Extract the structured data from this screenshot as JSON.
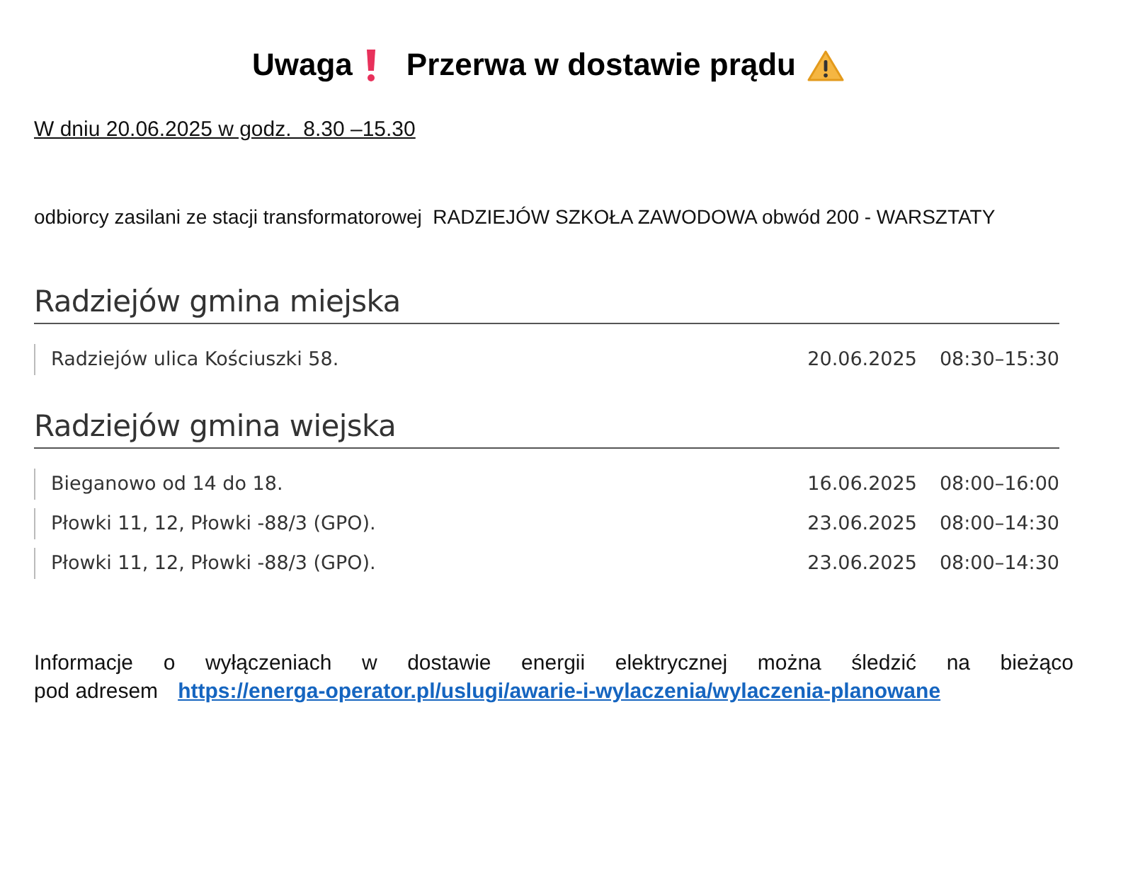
{
  "title": {
    "lead": "Uwaga",
    "text": "Przerwa w dostawie prądu"
  },
  "date_line": "W dniu 20.06.2025 w godz.  8.30 –15.30",
  "recipients": "odbiorcy zasilani ze stacji transformatorowej  RADZIEJÓW SZKOŁA ZAWODOWA obwód 200 - WARSZTATY",
  "sections": [
    {
      "heading": "Radziejów gmina miejska",
      "rows": [
        {
          "place": "Radziejów ulica Kościuszki 58.",
          "date": "20.06.2025",
          "hours": "08:30–15:30"
        }
      ]
    },
    {
      "heading": "Radziejów gmina wiejska",
      "rows": [
        {
          "place": "Bieganowo od 14 do 18.",
          "date": "16.06.2025",
          "hours": "08:00–16:00"
        },
        {
          "place": "Płowki 11, 12, Płowki -88/3 (GPO).",
          "date": "23.06.2025",
          "hours": "08:00–14:30"
        },
        {
          "place": "Płowki 11, 12, Płowki -88/3 (GPO).",
          "date": "23.06.2025",
          "hours": "08:00–14:30"
        }
      ]
    }
  ],
  "info": {
    "line_1": "Informacje o wyłączeniach w dostawie energii elektrycznej można śledzić na bieżąco",
    "line_2": "pod adresem",
    "link": "https://energa-operator.pl/uslugi/awarie-i-wylaczenia/wylaczenia-planowane"
  }
}
